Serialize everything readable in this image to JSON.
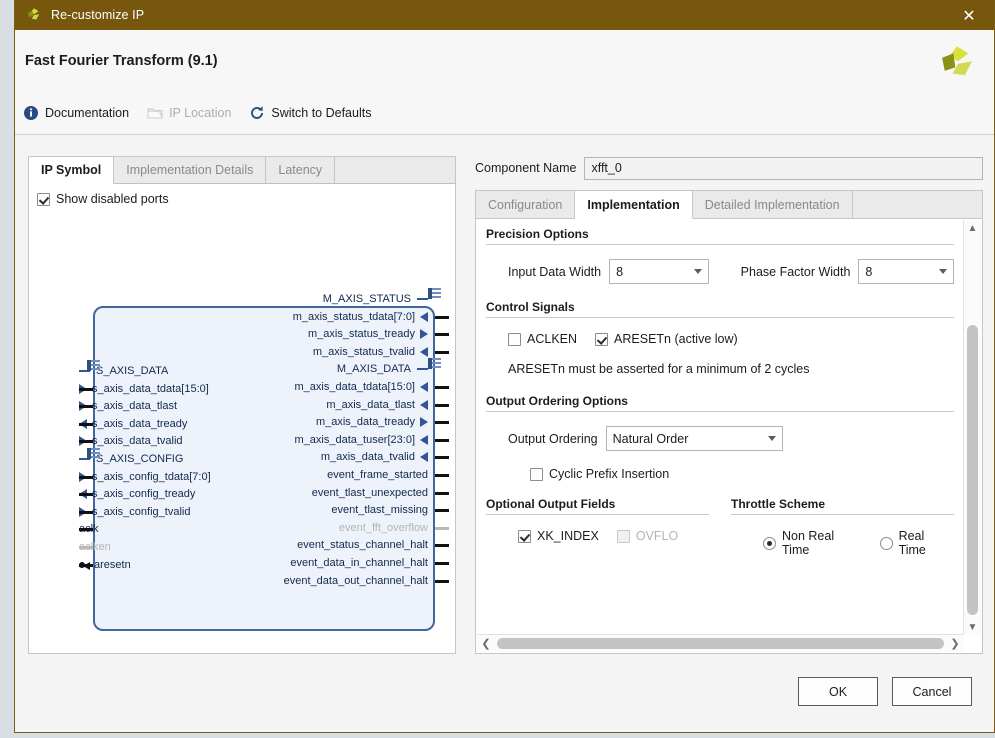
{
  "window": {
    "title": "Re-customize IP",
    "close_label": "✕",
    "logo_name": "xilinx-logo",
    "titlebar_color": "#77560d"
  },
  "header": {
    "title": "Fast Fourier Transform (9.1)",
    "toolbar": [
      {
        "label": "Documentation",
        "icon": "info-icon",
        "disabled": false
      },
      {
        "label": "IP Location",
        "icon": "folder-icon",
        "disabled": true
      },
      {
        "label": "Switch to Defaults",
        "icon": "refresh-icon",
        "disabled": false
      }
    ]
  },
  "left_panel": {
    "tabs": [
      {
        "label": "IP Symbol",
        "active": true
      },
      {
        "label": "Implementation Details",
        "active": false
      },
      {
        "label": "Latency",
        "active": false
      }
    ],
    "show_disabled_ports": {
      "label": "Show disabled ports",
      "checked": true
    },
    "symbol": {
      "left_ports": [
        {
          "name": "S_AXIS_DATA",
          "kind": "bus",
          "marker": "dash",
          "disabled": false
        },
        {
          "name": "s_axis_data_tdata[15:0]",
          "kind": "signal",
          "marker": "in",
          "disabled": false
        },
        {
          "name": "s_axis_data_tlast",
          "kind": "signal",
          "marker": "in",
          "disabled": false
        },
        {
          "name": "s_axis_data_tready",
          "kind": "signal",
          "marker": "out",
          "disabled": false
        },
        {
          "name": "s_axis_data_tvalid",
          "kind": "signal",
          "marker": "in",
          "disabled": false
        },
        {
          "name": "S_AXIS_CONFIG",
          "kind": "bus",
          "marker": "dash",
          "disabled": false
        },
        {
          "name": "s_axis_config_tdata[7:0]",
          "kind": "signal",
          "marker": "in",
          "disabled": false
        },
        {
          "name": "s_axis_config_tready",
          "kind": "signal",
          "marker": "out",
          "disabled": false
        },
        {
          "name": "s_axis_config_tvalid",
          "kind": "signal",
          "marker": "in",
          "disabled": false
        },
        {
          "name": "aclk",
          "kind": "clock",
          "marker": "none",
          "disabled": false
        },
        {
          "name": "aclken",
          "kind": "signal",
          "marker": "none",
          "disabled": true
        },
        {
          "name": "aresetn",
          "kind": "reset",
          "marker": "bullet",
          "disabled": false
        }
      ],
      "right_ports": [
        {
          "name": "M_AXIS_STATUS",
          "kind": "bus",
          "marker": "dash",
          "disabled": false
        },
        {
          "name": "m_axis_status_tdata[7:0]",
          "kind": "signal",
          "marker": "out",
          "disabled": false
        },
        {
          "name": "m_axis_status_tready",
          "kind": "signal",
          "marker": "in",
          "disabled": false
        },
        {
          "name": "m_axis_status_tvalid",
          "kind": "signal",
          "marker": "out",
          "disabled": false
        },
        {
          "name": "M_AXIS_DATA",
          "kind": "bus",
          "marker": "dash",
          "disabled": false
        },
        {
          "name": "m_axis_data_tdata[15:0]",
          "kind": "signal",
          "marker": "out",
          "disabled": false
        },
        {
          "name": "m_axis_data_tlast",
          "kind": "signal",
          "marker": "out",
          "disabled": false
        },
        {
          "name": "m_axis_data_tready",
          "kind": "signal",
          "marker": "in",
          "disabled": false
        },
        {
          "name": "m_axis_data_tuser[23:0]",
          "kind": "signal",
          "marker": "out",
          "disabled": false
        },
        {
          "name": "m_axis_data_tvalid",
          "kind": "signal",
          "marker": "out",
          "disabled": false
        },
        {
          "name": "event_frame_started",
          "kind": "signal",
          "marker": "none",
          "disabled": false
        },
        {
          "name": "event_tlast_unexpected",
          "kind": "signal",
          "marker": "none",
          "disabled": false
        },
        {
          "name": "event_tlast_missing",
          "kind": "signal",
          "marker": "none",
          "disabled": false
        },
        {
          "name": "event_fft_overflow",
          "kind": "signal",
          "marker": "none",
          "disabled": true
        },
        {
          "name": "event_status_channel_halt",
          "kind": "signal",
          "marker": "none",
          "disabled": false
        },
        {
          "name": "event_data_in_channel_halt",
          "kind": "signal",
          "marker": "none",
          "disabled": false
        },
        {
          "name": "event_data_out_channel_halt",
          "kind": "signal",
          "marker": "none",
          "disabled": false
        }
      ]
    }
  },
  "right_panel": {
    "component_name": {
      "label": "Component Name",
      "value": "xfft_0"
    },
    "tabs": [
      {
        "label": "Configuration",
        "active": false
      },
      {
        "label": "Implementation",
        "active": true
      },
      {
        "label": "Detailed Implementation",
        "active": false
      }
    ],
    "groups": {
      "precision": {
        "title": "Precision Options",
        "input_data_width": {
          "label": "Input Data Width",
          "value": "8"
        },
        "phase_factor_width": {
          "label": "Phase Factor Width",
          "value": "8"
        }
      },
      "control_signals": {
        "title": "Control Signals",
        "aclken": {
          "label": "ACLKEN",
          "checked": false
        },
        "aresetn": {
          "label": "ARESETn (active low)",
          "checked": true
        },
        "note": "ARESETn must be asserted for a minimum of 2 cycles"
      },
      "output_ordering": {
        "title": "Output Ordering Options",
        "output_ordering": {
          "label": "Output Ordering",
          "value": "Natural Order"
        },
        "cyclic_prefix": {
          "label": "Cyclic Prefix Insertion",
          "checked": false
        }
      },
      "optional_output_fields": {
        "title": "Optional Output Fields",
        "xk_index": {
          "label": "XK_INDEX",
          "checked": true,
          "disabled": false
        },
        "ovflo": {
          "label": "OVFLO",
          "checked": false,
          "disabled": true
        }
      },
      "throttle_scheme": {
        "title": "Throttle Scheme",
        "non_real_time": {
          "label": "Non Real Time",
          "selected": true
        },
        "real_time": {
          "label": "Real Time",
          "selected": false
        }
      }
    }
  },
  "footer": {
    "ok_label": "OK",
    "cancel_label": "Cancel"
  }
}
